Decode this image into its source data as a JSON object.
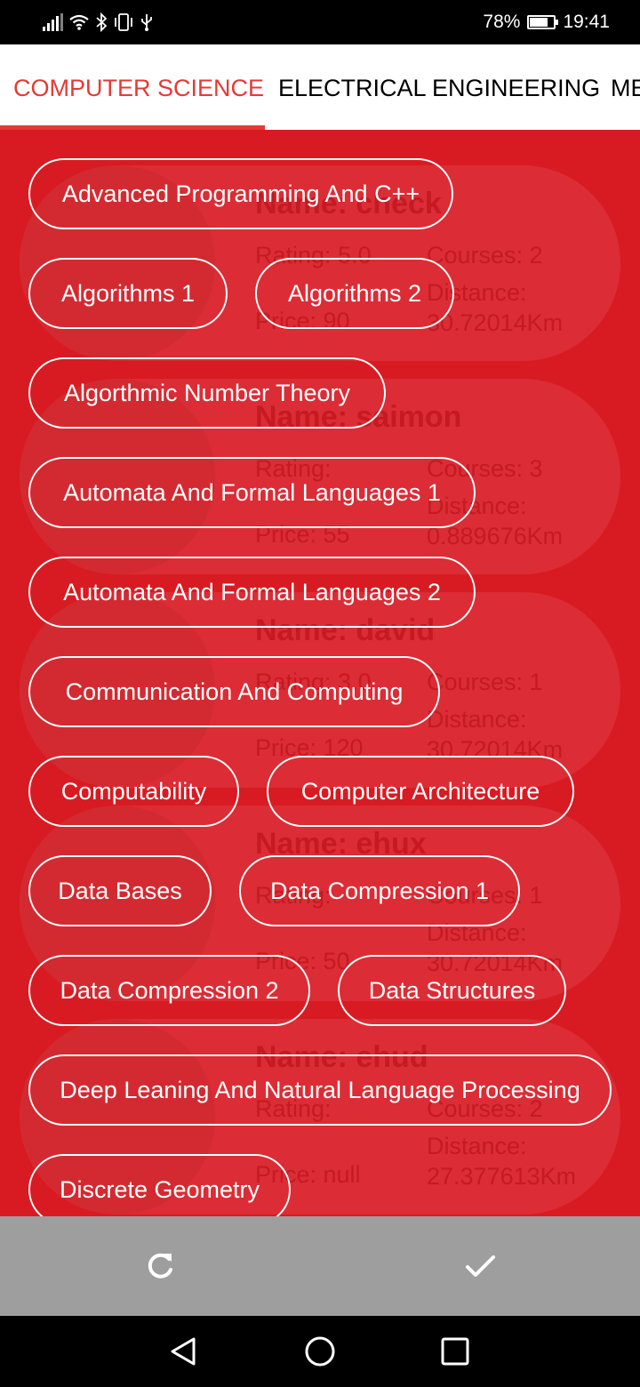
{
  "status_bar": {
    "battery_pct": "78%",
    "battery_level": 0.78,
    "time": "19:41",
    "icons": [
      "signal-icon",
      "wifi-icon",
      "bluetooth-icon",
      "vibrate-icon",
      "usb-icon"
    ]
  },
  "tabs": [
    {
      "label": "COMPUTER SCIENCE",
      "active": true
    },
    {
      "label": "ELECTRICAL ENGINEERING",
      "active": false
    },
    {
      "label": "ME",
      "active": false
    }
  ],
  "background_cards": [
    {
      "name": "Name: check",
      "rating": "Rating: 5.0",
      "courses": "Courses: 2",
      "price": "Price: 90",
      "distance_label": "Distance:",
      "distance": "30.72014Km"
    },
    {
      "name": "Name: saimon",
      "rating": "Rating:",
      "courses": "Courses: 3",
      "price": "Price: 55",
      "distance_label": "Distance:",
      "distance": "0.889676Km"
    },
    {
      "name": "Name: david",
      "rating": "Rating: 3.0",
      "courses": "Courses: 1",
      "price": "Price: 120",
      "distance_label": "Distance:",
      "distance": "30.72014Km"
    },
    {
      "name": "Name: ehux",
      "rating": "Rating:",
      "courses": "Courses: 1",
      "price": "Price: 50",
      "distance_label": "Distance:",
      "distance": "30.72014Km"
    },
    {
      "name": "Name: ehud",
      "rating": "Rating:",
      "courses": "Courses: 2",
      "price": "Price: null",
      "distance_label": "Distance:",
      "distance": "27.377613Km"
    }
  ],
  "chips": [
    "Advanced Programming And C++",
    "Algorithms 1",
    "Algorithms 2",
    "Algorthmic Number Theory",
    "Automata And Formal Languages 1",
    "Automata And Formal Languages 2",
    "Communication And Computing",
    "Computability",
    "Computer Architecture",
    "Data Bases",
    "Data Compression 1",
    "Data Compression 2",
    "Data Structures",
    "Deep Leaning And Natural Language Processing",
    "Discrete Geometry"
  ],
  "actions": {
    "reset_icon": "refresh-icon",
    "confirm_icon": "check-icon"
  },
  "nav": {
    "back_icon": "back-triangle-icon",
    "home_icon": "home-circle-icon",
    "recents_icon": "recents-square-icon"
  },
  "colors": {
    "accent": "#e53935",
    "content_bg": "#d81b22",
    "action_bar": "#9e9e9e",
    "chip_border": "#ffffff"
  }
}
